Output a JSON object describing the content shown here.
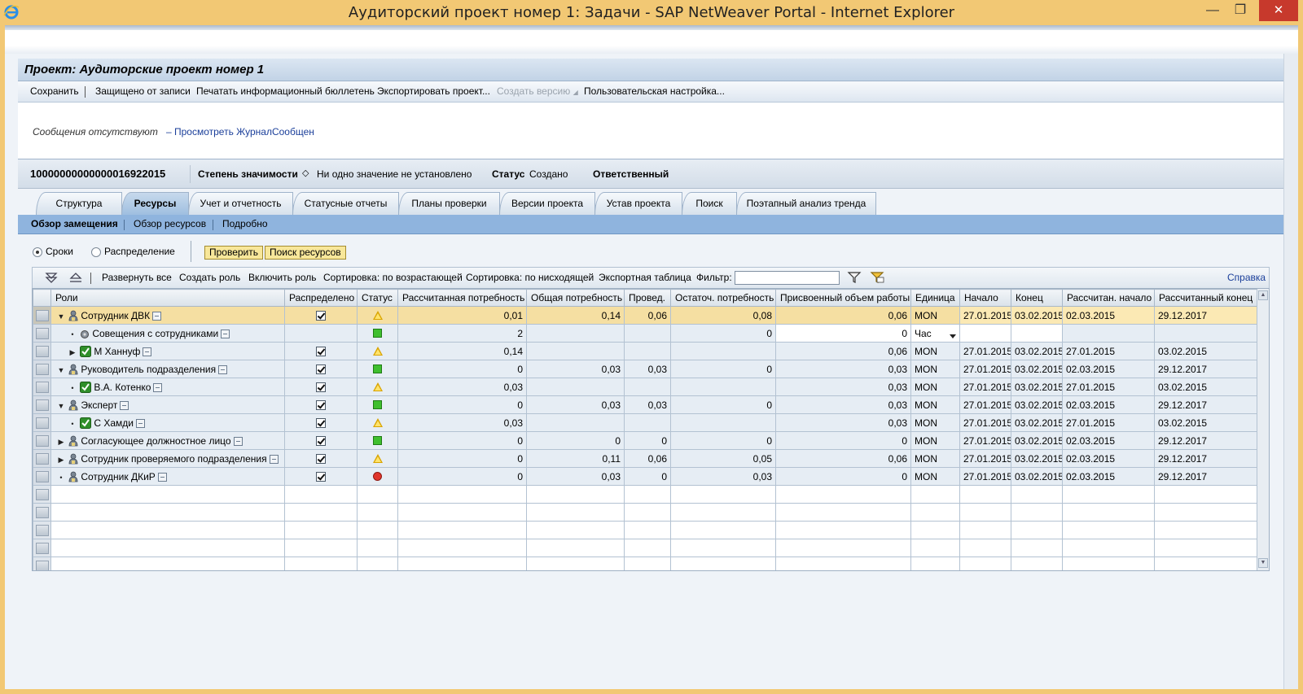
{
  "window": {
    "title": "Аудиторский проект номер 1: Задачи - SAP NetWeaver Portal - Internet Explorer",
    "min": "—",
    "max": "❐",
    "close": "✕"
  },
  "project": {
    "title": "Проект: Аудиторские проект номер 1"
  },
  "toolbar": {
    "save": "Сохранить",
    "write_protect": "Защищено от записи",
    "print_bulletin": "Печатать информационный бюллетень",
    "export_project": "Экспортировать проект...",
    "create_version": "Создать версию",
    "user_settings": "Пользовательская настройка..."
  },
  "messages": {
    "text": "Сообщения отсутствуют",
    "link": "– Просмотреть ЖурналСообщен"
  },
  "info": {
    "project_id": "10000000000000016922015",
    "priority_label": "Степень значимости",
    "priority_value": "Ни одно значение не установлено",
    "status_label": "Статус",
    "status_value": "Создано",
    "responsible_label": "Ответственный"
  },
  "tabs": [
    {
      "label": "Структура"
    },
    {
      "label": "Ресурсы"
    },
    {
      "label": "Учет и отчетность"
    },
    {
      "label": "Статусные отчеты"
    },
    {
      "label": "Планы проверки"
    },
    {
      "label": "Версии проекта"
    },
    {
      "label": "Устав проекта"
    },
    {
      "label": "Поиск"
    },
    {
      "label": "Поэтапный анализ тренда"
    }
  ],
  "subnav": {
    "overview_staffing": "Обзор замещения",
    "overview_resources": "Обзор ресурсов",
    "detail": "Подробно"
  },
  "options": {
    "dates": "Сроки",
    "distribution": "Распределение",
    "check": "Проверить",
    "find_resources": "Поиск ресурсов"
  },
  "table_toolbar": {
    "expand_all": "Развернуть все",
    "create_role": "Создать роль",
    "include_role": "Включить роль",
    "sort_asc": "Сортировка: по возрастающей",
    "sort_desc": "Сортировка: по нисходящей",
    "export_table": "Экспортная таблица",
    "filter_label": "Фильтр:",
    "filter_value": "",
    "help": "Справка"
  },
  "columns": [
    "Роли",
    "Распределено",
    "Статус",
    "Рассчитанная потребность",
    "Общая потребность",
    "Провед.",
    "Остаточ. потребность",
    "Присвоенный объем работы",
    "Единица",
    "Начало",
    "Конец",
    "Рассчитан. начало",
    "Рассчитанный конец"
  ],
  "rows": [
    {
      "level": 0,
      "expander": "▼",
      "icon": "person",
      "name": "Сотрудник ДВК",
      "distributed": true,
      "status": "yellow",
      "calc": "0,01",
      "total": "0,14",
      "done": "0,06",
      "remaining": "0,08",
      "assigned": "0,06",
      "unit": "MON",
      "start": "27.01.2015",
      "end": "03.02.2015",
      "calc_start": "02.03.2015",
      "calc_end": "29.12.2017",
      "highlight": true
    },
    {
      "level": 1,
      "expander": "•",
      "icon": "gear",
      "name": "Совещения с сотрудниками",
      "distributed": null,
      "status": "green",
      "calc": "2",
      "total": "",
      "done": "",
      "remaining": "0",
      "assigned": "0",
      "unit": "Час",
      "start": "",
      "end": "",
      "calc_start": "",
      "calc_end": "",
      "editable": true
    },
    {
      "level": 1,
      "expander": "▶",
      "icon": "check",
      "name": "М Ханнуф",
      "distributed": true,
      "status": "yellow",
      "calc": "0,14",
      "total": "",
      "done": "",
      "remaining": "",
      "assigned": "0,06",
      "unit": "MON",
      "start": "27.01.2015",
      "end": "03.02.2015",
      "calc_start": "27.01.2015",
      "calc_end": "03.02.2015"
    },
    {
      "level": 0,
      "expander": "▼",
      "icon": "person",
      "name": "Руководитель подразделения",
      "distributed": true,
      "status": "green",
      "calc": "0",
      "total": "0,03",
      "done": "0,03",
      "remaining": "0",
      "assigned": "0,03",
      "unit": "MON",
      "start": "27.01.2015",
      "end": "03.02.2015",
      "calc_start": "02.03.2015",
      "calc_end": "29.12.2017"
    },
    {
      "level": 1,
      "expander": "•",
      "icon": "check",
      "name": "В.А. Котенко",
      "distributed": true,
      "status": "yellow",
      "calc": "0,03",
      "total": "",
      "done": "",
      "remaining": "",
      "assigned": "0,03",
      "unit": "MON",
      "start": "27.01.2015",
      "end": "03.02.2015",
      "calc_start": "27.01.2015",
      "calc_end": "03.02.2015"
    },
    {
      "level": 0,
      "expander": "▼",
      "icon": "person",
      "name": "Эксперт",
      "distributed": true,
      "status": "green",
      "calc": "0",
      "total": "0,03",
      "done": "0,03",
      "remaining": "0",
      "assigned": "0,03",
      "unit": "MON",
      "start": "27.01.2015",
      "end": "03.02.2015",
      "calc_start": "02.03.2015",
      "calc_end": "29.12.2017"
    },
    {
      "level": 1,
      "expander": "•",
      "icon": "check",
      "name": "С Хамди",
      "distributed": true,
      "status": "yellow",
      "calc": "0,03",
      "total": "",
      "done": "",
      "remaining": "",
      "assigned": "0,03",
      "unit": "MON",
      "start": "27.01.2015",
      "end": "03.02.2015",
      "calc_start": "27.01.2015",
      "calc_end": "03.02.2015"
    },
    {
      "level": 0,
      "expander": "▶",
      "icon": "person",
      "name": "Согласующее должностное лицо",
      "distributed": true,
      "status": "green",
      "calc": "0",
      "total": "0",
      "done": "0",
      "remaining": "0",
      "assigned": "0",
      "unit": "MON",
      "start": "27.01.2015",
      "end": "03.02.2015",
      "calc_start": "02.03.2015",
      "calc_end": "29.12.2017"
    },
    {
      "level": 0,
      "expander": "▶",
      "icon": "person",
      "name": "Сотрудник проверяемого подразделения",
      "distributed": true,
      "status": "yellow",
      "calc": "0",
      "total": "0,11",
      "done": "0,06",
      "remaining": "0,05",
      "assigned": "0,06",
      "unit": "MON",
      "start": "27.01.2015",
      "end": "03.02.2015",
      "calc_start": "02.03.2015",
      "calc_end": "29.12.2017"
    },
    {
      "level": 0,
      "expander": "•",
      "icon": "person",
      "name": "Сотрудник ДКиР",
      "distributed": true,
      "status": "red",
      "calc": "0",
      "total": "0,03",
      "done": "0",
      "remaining": "0,03",
      "assigned": "0",
      "unit": "MON",
      "start": "27.01.2015",
      "end": "03.02.2015",
      "calc_start": "02.03.2015",
      "calc_end": "29.12.2017"
    }
  ],
  "empty_rows": 5,
  "colors": {
    "title_bar": "#f2c874",
    "highlight_row": "#f5dfa2",
    "subnav": "#8fb4de",
    "button_yellow": "#f8e79a"
  }
}
